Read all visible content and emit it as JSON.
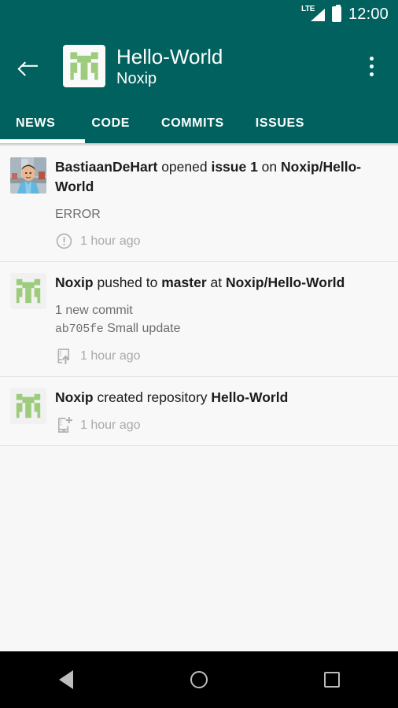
{
  "statusbar": {
    "network": "LTE",
    "time": "12:00",
    "signal_icon": "signal-bars-icon",
    "battery_icon": "battery-full-icon"
  },
  "appbar": {
    "back_icon": "back-arrow-icon",
    "avatar_icon": "repo-identicon",
    "title": "Hello-World",
    "subtitle": "Noxip",
    "overflow_icon": "overflow-menu-icon",
    "background_color": "#00615e"
  },
  "tabs": {
    "active": "NEWS",
    "items": [
      {
        "label": "NEWS"
      },
      {
        "label": "CODE"
      },
      {
        "label": "COMMITS"
      },
      {
        "label": "ISSUES"
      }
    ]
  },
  "feed": {
    "items": [
      {
        "avatar_icon": "user-photo-avatar",
        "headline_parts": [
          {
            "text": "BastiaanDeHart",
            "bold": true
          },
          {
            "text": " opened ",
            "bold": false
          },
          {
            "text": "issue 1",
            "bold": true
          },
          {
            "text": " on ",
            "bold": false
          },
          {
            "text": "Noxip/Hello-World",
            "bold": true
          }
        ],
        "body": "ERROR",
        "meta_icon": "issue-opened-icon",
        "meta_text": "1 hour ago"
      },
      {
        "avatar_icon": "repo-identicon",
        "headline_parts": [
          {
            "text": "Noxip",
            "bold": true
          },
          {
            "text": " pushed to ",
            "bold": false
          },
          {
            "text": "master",
            "bold": true
          },
          {
            "text": " at ",
            "bold": false
          },
          {
            "text": "Noxip/Hello-World",
            "bold": true
          }
        ],
        "body": "1 new commit",
        "commit_sha": "ab705fe",
        "commit_message": "Small update",
        "meta_icon": "repo-push-icon",
        "meta_text": "1 hour ago"
      },
      {
        "avatar_icon": "repo-identicon",
        "headline_parts": [
          {
            "text": "Noxip",
            "bold": true
          },
          {
            "text": " created repository ",
            "bold": false
          },
          {
            "text": "Hello-World",
            "bold": true
          }
        ],
        "meta_icon": "repo-created-icon",
        "meta_text": "1 hour ago"
      }
    ]
  },
  "navbar": {
    "back_icon": "nav-back-icon",
    "home_icon": "nav-home-icon",
    "recents_icon": "nav-recents-icon"
  },
  "colors": {
    "accent": "#00615e",
    "identicon_green": "#9ccc7c",
    "text_primary": "#1c1c1c",
    "text_muted": "#a9a9a9"
  }
}
